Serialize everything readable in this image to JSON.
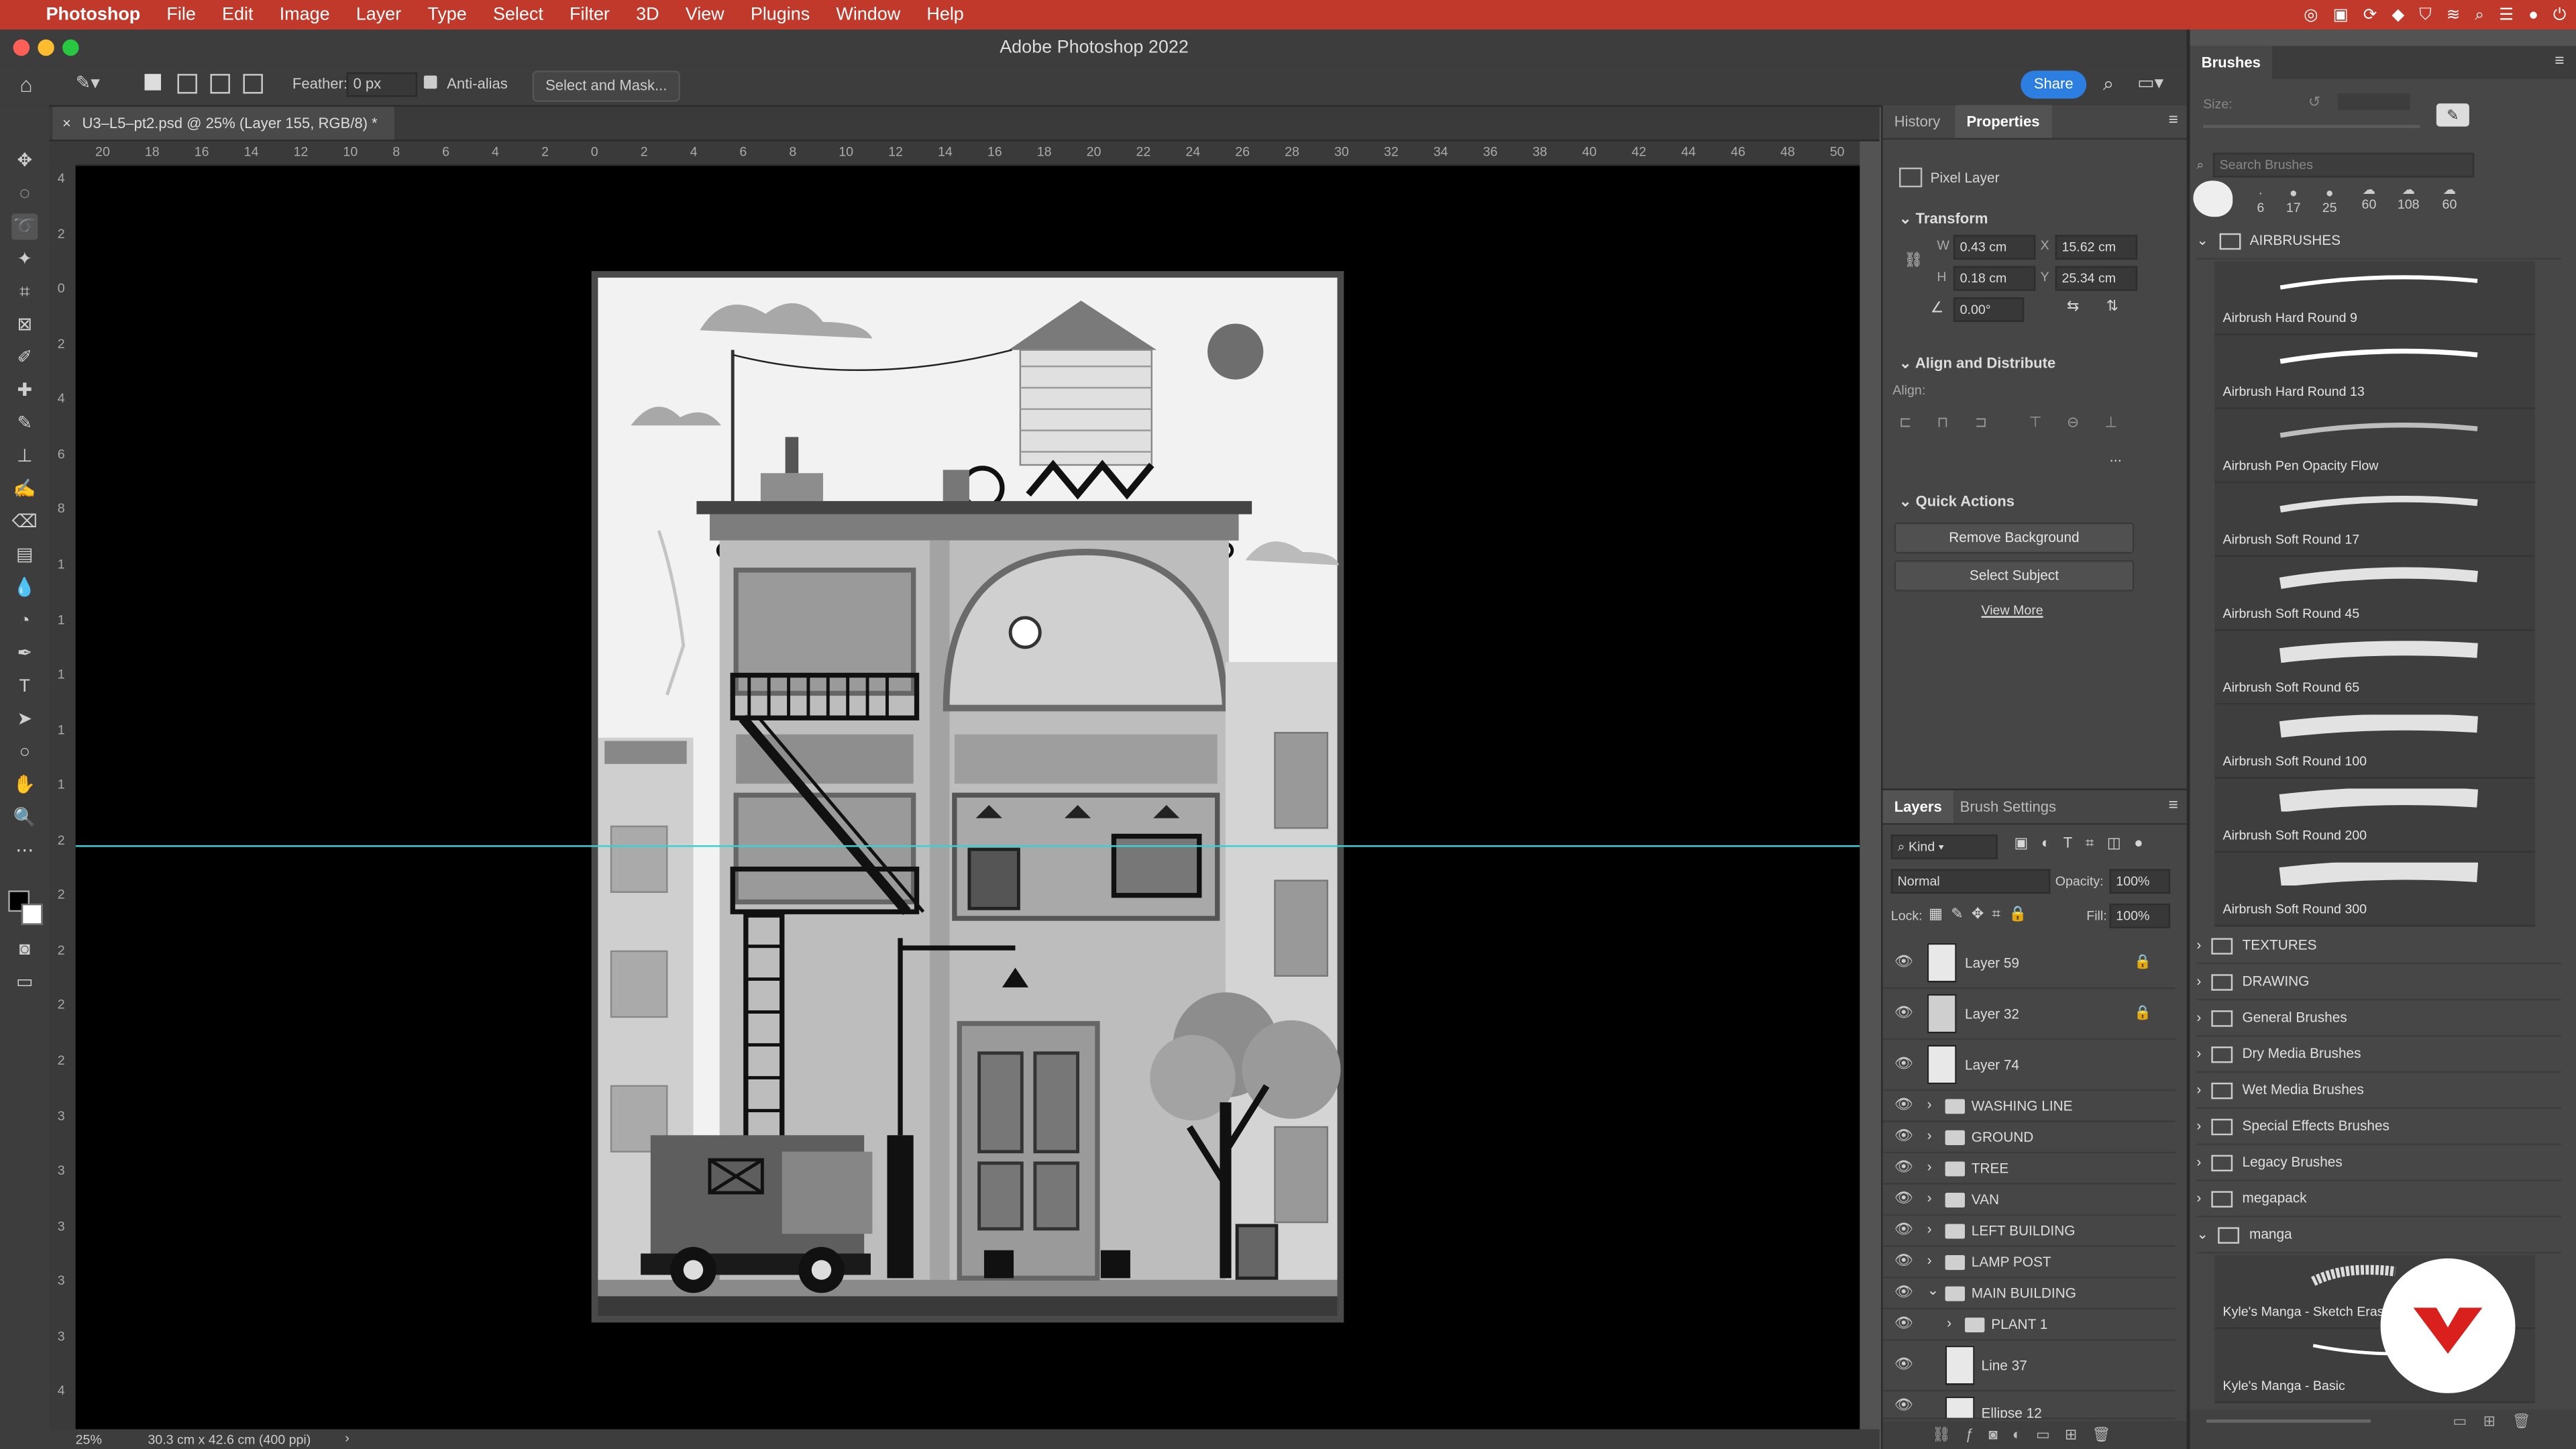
{
  "menubar": {
    "app": "Photoshop",
    "items": [
      "File",
      "Edit",
      "Image",
      "Layer",
      "Type",
      "Select",
      "Filter",
      "3D",
      "View",
      "Plugins",
      "Window",
      "Help"
    ]
  },
  "window": {
    "title": "Adobe Photoshop 2022"
  },
  "options": {
    "feather_label": "Feather:",
    "feather_value": "0 px",
    "antialias_label": "Anti-alias",
    "select_mask_label": "Select and Mask...",
    "share_label": "Share"
  },
  "document": {
    "tab_title": "U3–L5–pt2.psd @ 25% (Layer 155, RGB/8) *",
    "zoom": "25%",
    "dimensions": "30.3 cm x 42.6 cm (400 ppi)"
  },
  "ruler": {
    "h_labels": [
      "20",
      "18",
      "16",
      "14",
      "12",
      "10",
      "8",
      "6",
      "4",
      "2",
      "0",
      "2",
      "4",
      "6",
      "8",
      "10",
      "12",
      "14",
      "16",
      "18",
      "20",
      "22",
      "24",
      "26",
      "28",
      "30",
      "32",
      "34",
      "36",
      "38",
      "40",
      "42",
      "44",
      "46",
      "48",
      "50"
    ],
    "v_labels": [
      "4",
      "2",
      "0",
      "2",
      "4",
      "6",
      "8",
      "1",
      "1",
      "1",
      "1",
      "1",
      "2",
      "2",
      "2",
      "2",
      "2",
      "3",
      "3",
      "3",
      "3",
      "3",
      "4"
    ]
  },
  "properties": {
    "tabs": [
      "History",
      "Properties"
    ],
    "layer_type": "Pixel Layer",
    "transform_title": "Transform",
    "w_label": "W",
    "w_value": "0.43 cm",
    "x_label": "X",
    "x_value": "15.62 cm",
    "h_label": "H",
    "h_value": "0.18 cm",
    "y_label": "Y",
    "y_value": "25.34 cm",
    "angle_value": "0.00°",
    "align_title": "Align and Distribute",
    "align_label": "Align:",
    "more": "...",
    "quick_title": "Quick Actions",
    "remove_bg": "Remove Background",
    "select_subject": "Select Subject",
    "view_more": "View More"
  },
  "layers": {
    "tabs": [
      "Layers",
      "Brush Settings"
    ],
    "filter_kind": "Kind",
    "blend_mode": "Normal",
    "opacity_label": "Opacity:",
    "opacity_value": "100%",
    "lock_label": "Lock:",
    "fill_label": "Fill:",
    "fill_value": "100%",
    "items": [
      {
        "name": "Layer 59",
        "type": "pixel",
        "locked": true
      },
      {
        "name": "Layer 32",
        "type": "pixel",
        "locked": true
      },
      {
        "name": "Layer 74",
        "type": "pixel",
        "locked": false
      },
      {
        "name": "WASHING LINE",
        "type": "group"
      },
      {
        "name": "GROUND",
        "type": "group"
      },
      {
        "name": "TREE",
        "type": "group"
      },
      {
        "name": "VAN",
        "type": "group"
      },
      {
        "name": "LEFT BUILDING",
        "type": "group"
      },
      {
        "name": "LAMP POST",
        "type": "group"
      },
      {
        "name": "MAIN BUILDING",
        "type": "group"
      },
      {
        "name": "PLANT 1",
        "type": "group"
      },
      {
        "name": "Line 37",
        "type": "pixel"
      },
      {
        "name": "Ellipse 12",
        "type": "pixel"
      }
    ]
  },
  "brushes": {
    "title": "Brushes",
    "size_label": "Size:",
    "search_placeholder": "Search Brushes",
    "presets": [
      "6",
      "17",
      "25",
      "60",
      "108",
      "60"
    ],
    "open_folder": "AIRBRUSHES",
    "items": [
      "Airbrush Hard Round 9",
      "Airbrush Hard Round 13",
      "Airbrush Pen Opacity Flow",
      "Airbrush Soft Round 17",
      "Airbrush Soft Round 45",
      "Airbrush Soft Round 65",
      "Airbrush Soft Round 100",
      "Airbrush Soft Round 200",
      "Airbrush Soft Round 300"
    ],
    "folders": [
      "TEXTURES",
      "DRAWING",
      "General Brushes",
      "Dry Media Brushes",
      "Wet Media Brushes",
      "Special Effects Brushes",
      "Legacy Brushes",
      "megapack",
      "manga"
    ],
    "manga_items": [
      "Kyle's Manga - Sketch Eraser",
      "Kyle's Manga - Basic"
    ]
  },
  "colors": {
    "menubar": "#c0392b",
    "accent": "#2c7fe0",
    "logo": "#d9201c"
  }
}
